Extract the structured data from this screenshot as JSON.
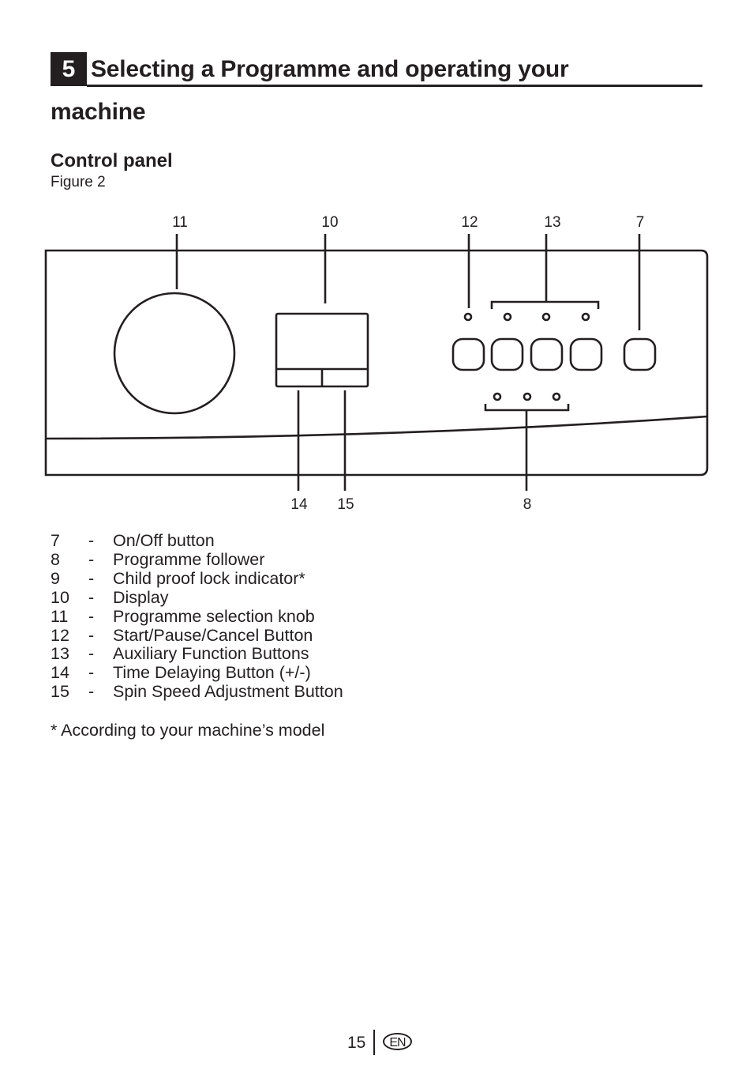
{
  "section": {
    "number": "5",
    "title_line1": "Selecting a Programme and operating your",
    "title_line2": "machine"
  },
  "subsection": {
    "title": "Control panel",
    "figure_caption": "Figure 2"
  },
  "diagram": {
    "callouts_top": [
      "11",
      "10",
      "12",
      "13",
      "7"
    ],
    "callouts_bottom": [
      "14",
      "15",
      "8"
    ]
  },
  "legend": [
    {
      "num": "7",
      "dash": "-",
      "label": "On/Off button"
    },
    {
      "num": "8",
      "dash": "-",
      "label": "Programme follower"
    },
    {
      "num": "9",
      "dash": "-",
      "label": "Child proof lock indicator*"
    },
    {
      "num": "10",
      "dash": "-",
      "label": "Display"
    },
    {
      "num": "11",
      "dash": "-",
      "label": "Programme selection knob"
    },
    {
      "num": "12",
      "dash": "-",
      "label": "Start/Pause/Cancel Button"
    },
    {
      "num": "13",
      "dash": "-",
      "label": "Auxiliary Function Buttons"
    },
    {
      "num": "14",
      "dash": "-",
      "label": "Time Delaying Button (+/-)"
    },
    {
      "num": "15",
      "dash": "-",
      "label": "Spin Speed Adjustment Button"
    }
  ],
  "footnote": "* According to your machine’s model",
  "footer": {
    "page_number": "15",
    "language": "EN"
  }
}
